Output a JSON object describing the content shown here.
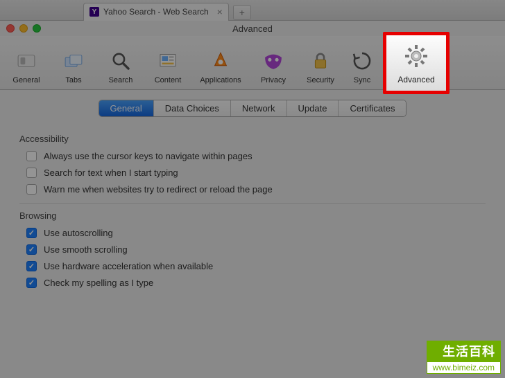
{
  "browserTab": {
    "title": "Yahoo Search - Web Search",
    "faviconLetter": "Y"
  },
  "window": {
    "title": "Advanced"
  },
  "toolbar": [
    {
      "key": "general",
      "label": "General"
    },
    {
      "key": "tabs",
      "label": "Tabs"
    },
    {
      "key": "search",
      "label": "Search"
    },
    {
      "key": "content",
      "label": "Content"
    },
    {
      "key": "applications",
      "label": "Applications"
    },
    {
      "key": "privacy",
      "label": "Privacy"
    },
    {
      "key": "security",
      "label": "Security"
    },
    {
      "key": "sync",
      "label": "Sync"
    },
    {
      "key": "advanced",
      "label": "Advanced",
      "highlighted": true
    }
  ],
  "subtabs": [
    {
      "label": "General",
      "active": true
    },
    {
      "label": "Data Choices",
      "active": false
    },
    {
      "label": "Network",
      "active": false
    },
    {
      "label": "Update",
      "active": false
    },
    {
      "label": "Certificates",
      "active": false
    }
  ],
  "sections": {
    "accessibility": {
      "title": "Accessibility",
      "options": [
        {
          "label": "Always use the cursor keys to navigate within pages",
          "checked": false
        },
        {
          "label": "Search for text when I start typing",
          "checked": false
        },
        {
          "label": "Warn me when websites try to redirect or reload the page",
          "checked": false
        }
      ]
    },
    "browsing": {
      "title": "Browsing",
      "options": [
        {
          "label": "Use autoscrolling",
          "checked": true
        },
        {
          "label": "Use smooth scrolling",
          "checked": true
        },
        {
          "label": "Use hardware acceleration when available",
          "checked": true
        },
        {
          "label": "Check my spelling as I type",
          "checked": true
        }
      ]
    }
  },
  "watermark": {
    "top": "生活百科",
    "bottom": "www.bimeiz.com"
  }
}
